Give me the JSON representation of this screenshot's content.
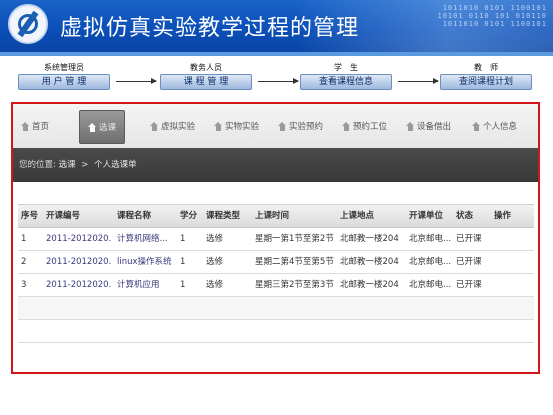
{
  "header": {
    "title": "虚拟仿真实验教学过程的管理",
    "binary_text": "1011010 0101 1100101 10101 0110 101 010110 1011010 0101 1100101"
  },
  "roles": [
    {
      "label": "系统管理员",
      "button": "用 户 管 理"
    },
    {
      "label": "教务人员",
      "button": "课 程 管 理"
    },
    {
      "label": "学　生",
      "button": "查看课程信息"
    },
    {
      "label": "教　师",
      "button": "查阅课程计划"
    }
  ],
  "nav": {
    "items": [
      {
        "label": "首页",
        "icon": "home-icon"
      },
      {
        "label": "选课",
        "icon": "home-icon",
        "active": true
      },
      {
        "label": "虚拟实验",
        "icon": "home-icon"
      },
      {
        "label": "实物实验",
        "icon": "home-icon"
      },
      {
        "label": "实验预约",
        "icon": "home-icon"
      },
      {
        "label": "预约工位",
        "icon": "home-icon"
      },
      {
        "label": "设备借出",
        "icon": "home-icon"
      },
      {
        "label": "个人信息",
        "icon": "home-icon"
      }
    ]
  },
  "breadcrumb": {
    "prefix": "您的位置:",
    "link": "选课",
    "separator": ">",
    "current": "个人选课单"
  },
  "table": {
    "headers": [
      "序号",
      "开课编号",
      "课程名称",
      "学分",
      "课程类型",
      "上课时间",
      "上课地点",
      "开课单位",
      "状态",
      "操作"
    ],
    "rows": [
      [
        "1",
        "2011-2012020...",
        "计算机网络...",
        "1",
        "选修",
        "星期一第1节至第2节",
        "北邮教一楼204",
        "北京邮电...",
        "已开课",
        ""
      ],
      [
        "2",
        "2011-2012020...",
        "linux操作系统",
        "1",
        "选修",
        "星期二第4节至第5节",
        "北邮教一楼204",
        "北京邮电...",
        "已开课",
        ""
      ],
      [
        "3",
        "2011-2012020...",
        "计算机应用",
        "1",
        "选修",
        "星期三第2节至第3节",
        "北邮教一楼204",
        "北京邮电...",
        "已开课",
        ""
      ]
    ]
  },
  "colors": {
    "banner": "#0b4fb8",
    "frame_border": "#d6141c",
    "breadcrumb_bg": "#3f3f3f"
  }
}
